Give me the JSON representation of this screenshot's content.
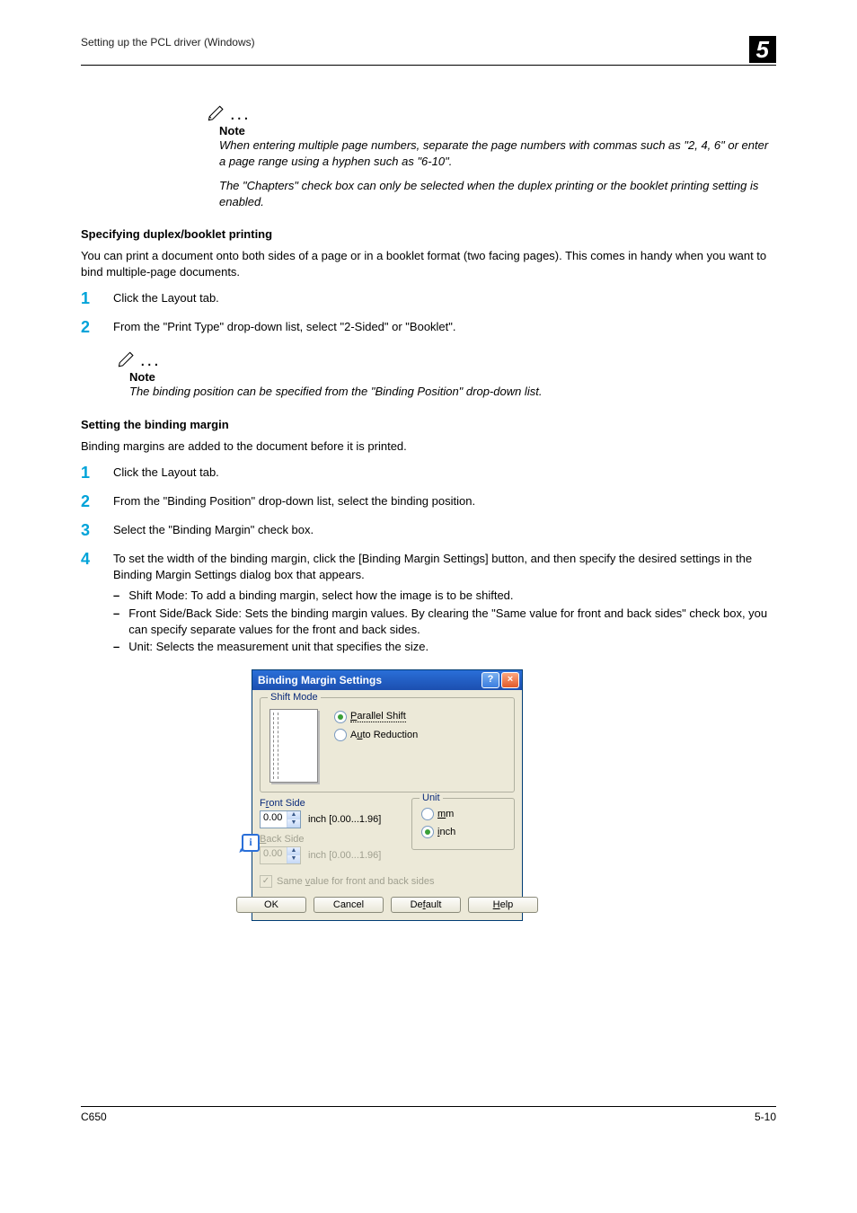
{
  "header": {
    "left": "Setting up the PCL driver (Windows)",
    "chapter": "5"
  },
  "note1": {
    "label": "Note",
    "p1": "When entering multiple page numbers, separate the page numbers with commas such as \"2, 4, 6\" or enter a page range using a hyphen such as \"6-10\".",
    "p2": "The \"Chapters\" check box can only be selected when the duplex printing or the booklet printing setting is enabled."
  },
  "sectionA": {
    "title": "Specifying duplex/booklet printing",
    "intro": "You can print a document onto both sides of a page or in a booklet format (two facing pages). This comes in handy when you want to bind multiple-page documents.",
    "step1": "Click the Layout tab.",
    "step2": "From the \"Print Type\" drop-down list, select \"2-Sided\" or \"Booklet\"."
  },
  "note2": {
    "label": "Note",
    "p1": "The binding position can be specified from the \"Binding Position\" drop-down list."
  },
  "sectionB": {
    "title": "Setting the binding margin",
    "intro": "Binding margins are added to the document before it is printed.",
    "step1": "Click the Layout tab.",
    "step2": "From the \"Binding Position\" drop-down list, select the binding position.",
    "step3": "Select the \"Binding Margin\" check box.",
    "step4_intro": "To set the width of the binding margin, click the [Binding Margin Settings] button, and then specify the desired settings in the Binding Margin Settings dialog box that appears.",
    "step4_b1": "Shift Mode: To add a binding margin, select how the image is to be shifted.",
    "step4_b2": "Front Side/Back Side: Sets the binding margin values. By clearing the \"Same value for front and back sides\" check box, you can specify separate values for the front and back sides.",
    "step4_b3": "Unit: Selects the measurement unit that specifies the size."
  },
  "dialog": {
    "title": "Binding Margin Settings",
    "shift_mode_legend": "Shift Mode",
    "radio_parallel": "Parallel Shift",
    "radio_auto": "Auto Reduction",
    "front_side_label": "Front Side",
    "front_value": "0.00",
    "front_range": "inch [0.00...1.96]",
    "back_side_label": "Back Side",
    "back_value": "0.00",
    "back_range": "inch [0.00...1.96]",
    "unit_legend": "Unit",
    "radio_mm": "mm",
    "radio_inch": "inch",
    "same_value_label": "Same value for front and back sides",
    "btn_ok": "OK",
    "btn_cancel": "Cancel",
    "btn_default": "Default",
    "btn_help": "Help"
  },
  "footer": {
    "left": "C650",
    "right": "5-10"
  }
}
